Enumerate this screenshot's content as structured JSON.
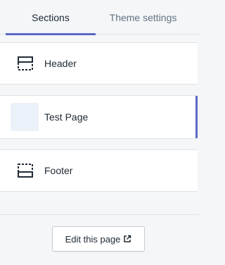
{
  "tabs": {
    "sections_label": "Sections",
    "theme_settings_label": "Theme settings",
    "active": "Sections"
  },
  "sections": {
    "header_label": "Header",
    "test_page_label": "Test Page",
    "footer_label": "Footer"
  },
  "footer_actions": {
    "edit_page_label": "Edit this page"
  },
  "icons": {
    "header": "header-layout-icon",
    "footer": "footer-layout-icon",
    "external": "external-link-icon"
  },
  "colors": {
    "accent": "#5c6ac4",
    "background": "#f4f6f8",
    "card": "#ffffff",
    "thumbnail": "#ebf1f8"
  }
}
